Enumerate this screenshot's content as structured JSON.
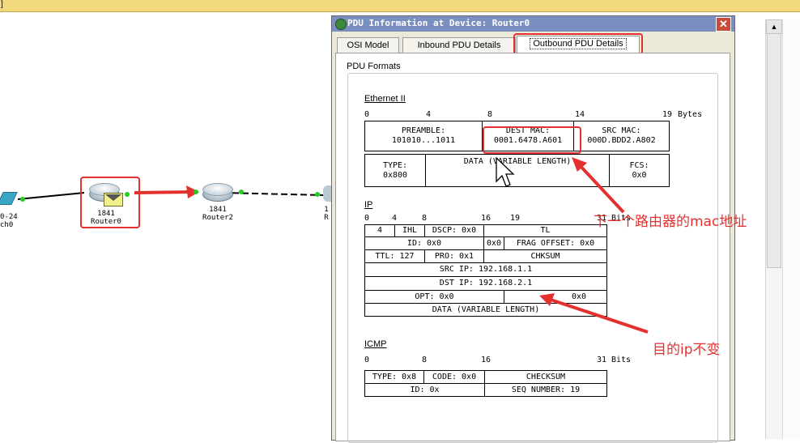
{
  "topbar": {
    "text": "]"
  },
  "canvas": {
    "left_node": {
      "label1": "0-24",
      "label2": "ch0"
    },
    "router0": {
      "label1": "1841",
      "label2": "Router0"
    },
    "router2": {
      "label1": "1841",
      "label2": "Router2"
    },
    "right_node": {
      "label1": "1",
      "label2": "R"
    }
  },
  "dialog": {
    "title": "PDU Information at Device: Router0",
    "close": "✕",
    "tabs": [
      "OSI Model",
      "Inbound PDU Details",
      "Outbound PDU Details"
    ],
    "group_label": "PDU Formats",
    "ethernet": {
      "title": "Ethernet II",
      "ruler": [
        "0",
        "4",
        "8",
        "14",
        "19",
        "Bytes"
      ],
      "preamble_label": "PREAMBLE:",
      "preamble_value": "101010...1011",
      "dest_label": "DEST MAC:",
      "dest_value": "0001.6478.A601",
      "src_label": "SRC MAC:",
      "src_value": "000D.BDD2.A802",
      "type_label": "TYPE:",
      "type_value": "0x800",
      "data": "DATA (VARIABLE LENGTH)",
      "fcs_label": "FCS:",
      "fcs_value": "0x0"
    },
    "ip": {
      "title": "IP",
      "ruler": [
        "0",
        "4",
        "8",
        "16",
        "19",
        "31",
        "Bits"
      ],
      "version": "4",
      "ihl": "IHL",
      "dscp": "DSCP: 0x0",
      "tl": "TL",
      "id": "ID: 0x0",
      "flags": "0x0",
      "frag": "FRAG OFFSET: 0x0",
      "ttl": "TTL: 127",
      "pro": "PRO: 0x1",
      "chksum": "CHKSUM",
      "src": "SRC IP: 192.168.1.1",
      "dst": "DST IP: 192.168.2.1",
      "opt": "OPT: 0x0",
      "opt_pad": "0x0",
      "data": "DATA (VARIABLE LENGTH)"
    },
    "icmp": {
      "title": "ICMP",
      "ruler": [
        "0",
        "8",
        "16",
        "31",
        "Bits"
      ],
      "type": "TYPE: 0x8",
      "code": "CODE: 0x0",
      "checksum": "CHECKSUM",
      "id": "ID: 0x",
      "seq": "SEQ NUMBER: 19"
    }
  },
  "annotations": {
    "mac_note": "下一个路由器的mac地址",
    "ip_note": "目的ip不变"
  },
  "colors": {
    "annotation": "#e53030",
    "title_bar": "#7b8ec0",
    "link": "#22cc22"
  }
}
